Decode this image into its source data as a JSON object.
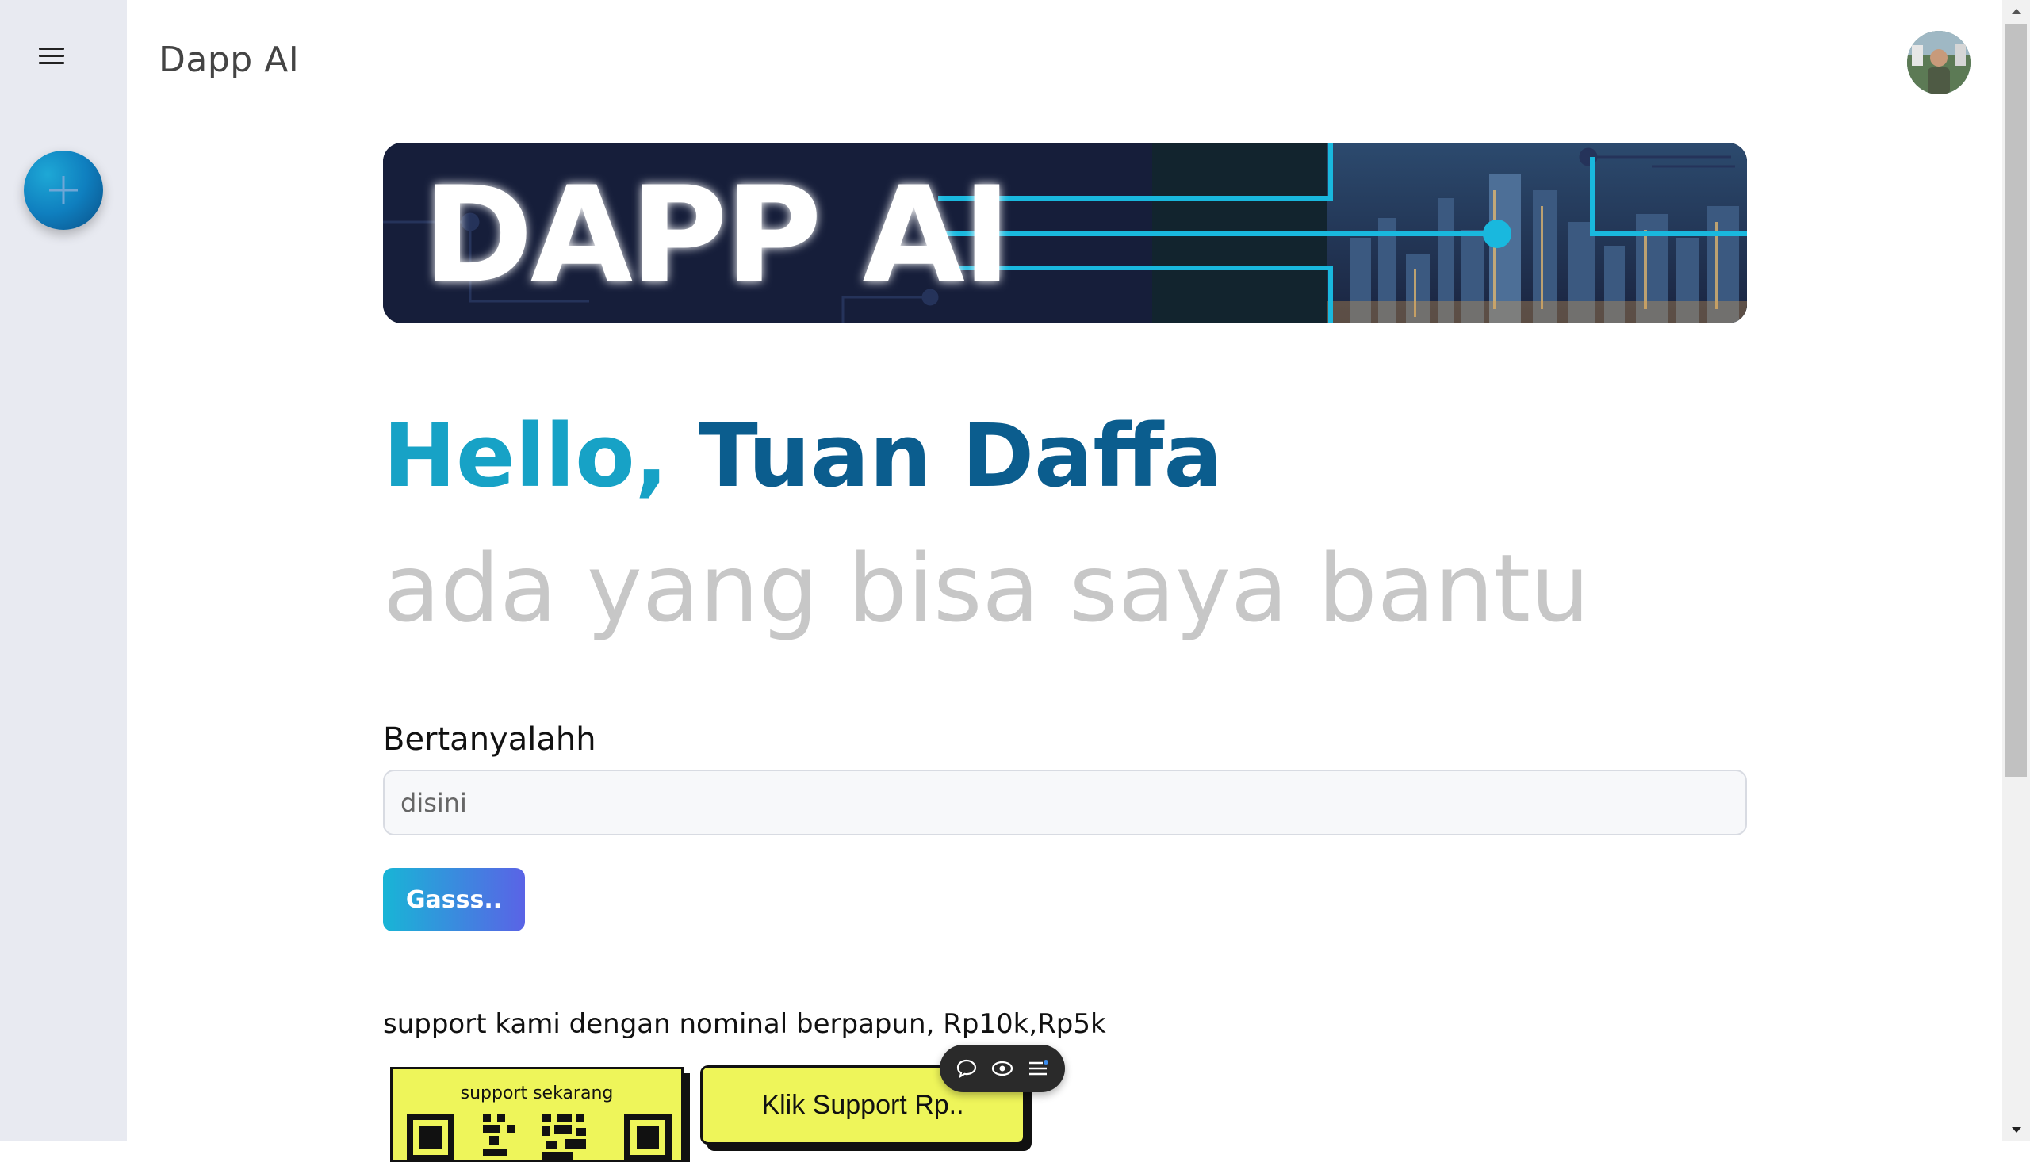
{
  "app": {
    "title": "Dapp AI"
  },
  "banner": {
    "text": "DAPP AI"
  },
  "greeting": {
    "hello": "Hello,",
    "name": "Tuan Daffa",
    "sub": "ada yang bisa saya bantu"
  },
  "form": {
    "label": "Bertanyalahh",
    "placeholder": "disini",
    "value": "",
    "submit_label": "Gasss.."
  },
  "support": {
    "text": "support kami dengan nominal berpapun, Rp10k,Rp5k",
    "qr_card_label": "support sekarang",
    "button_label": "Klik Support Rp.."
  },
  "icons": {
    "menu": "hamburger-menu-icon",
    "new_chat": "plus-icon",
    "comment": "chat-bubble-icon",
    "eye": "eye-icon",
    "list": "list-icon"
  },
  "colors": {
    "accent": "#17a2c6",
    "accent_dark": "#0b5d8e",
    "button_gradient_start": "#18b5d6",
    "button_gradient_end": "#5a63e6",
    "support_yellow": "#eef55a",
    "sidebar_bg": "#e8eaf1"
  }
}
